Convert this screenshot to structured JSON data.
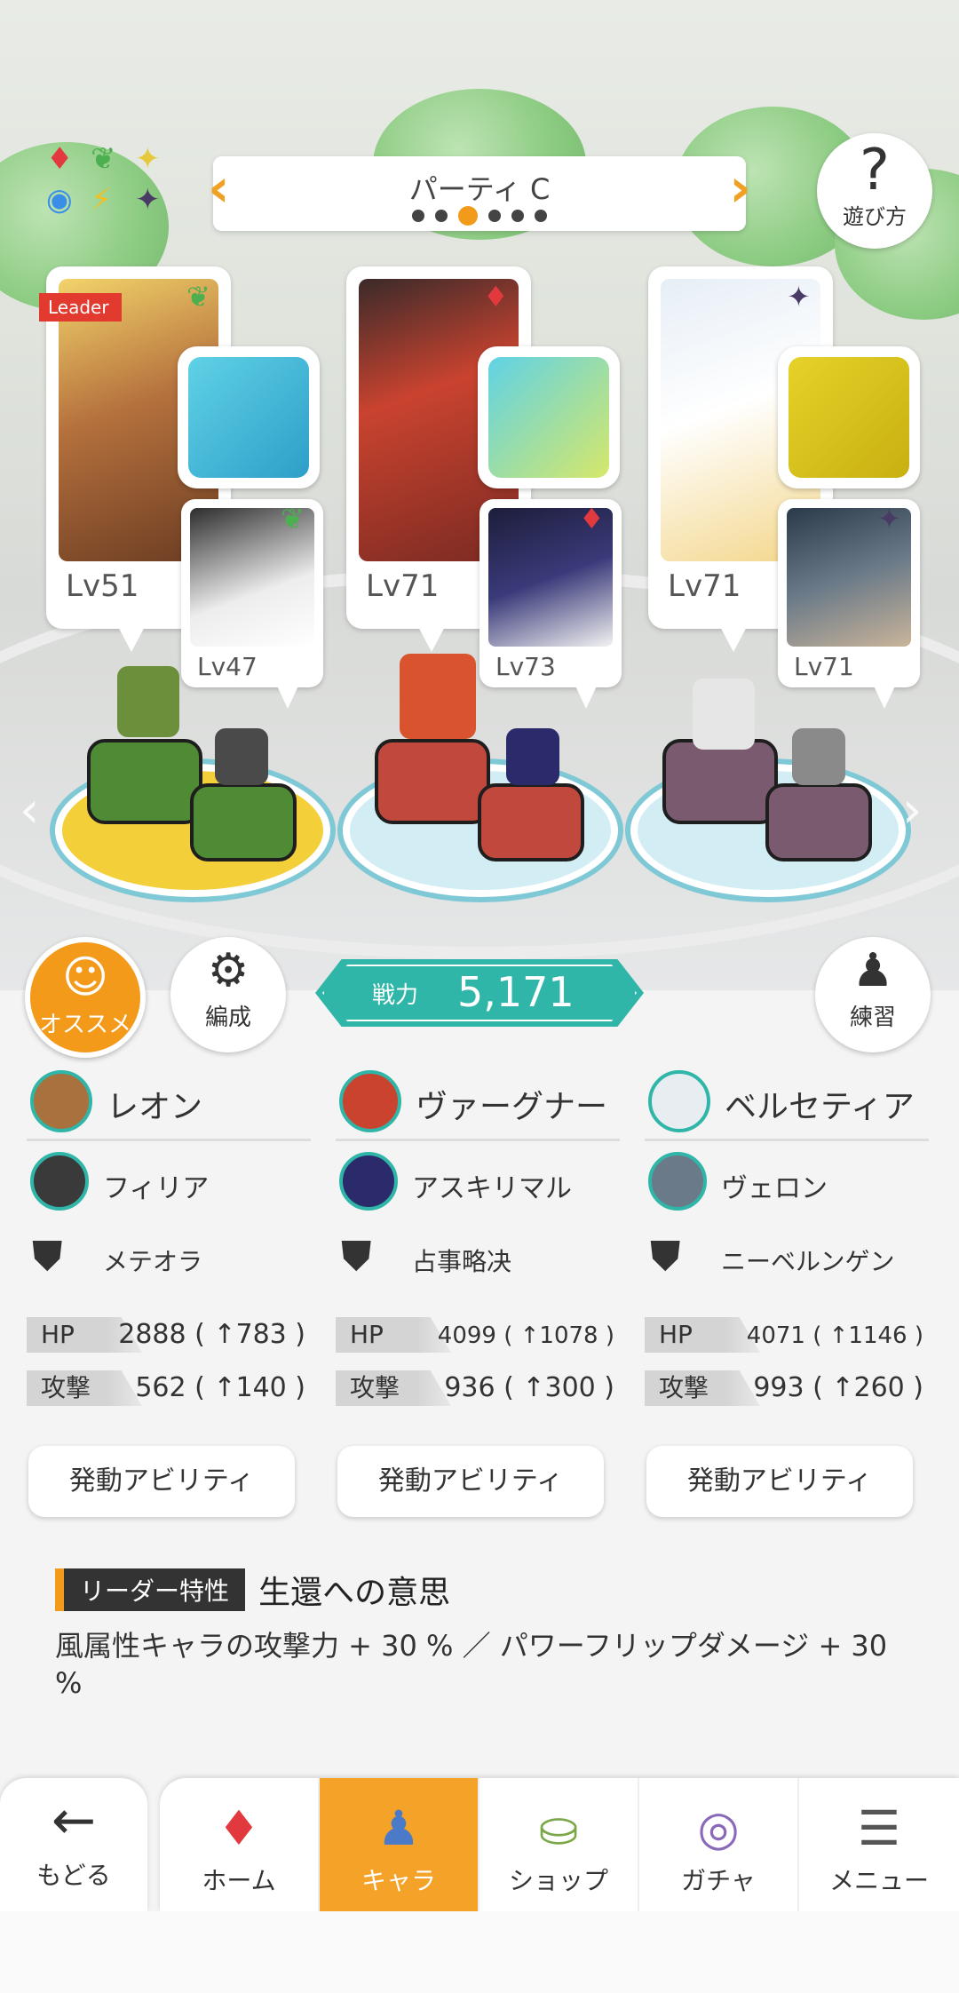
{
  "header": {
    "party_title": "パーティ C",
    "help_label": "遊び方",
    "help_icon": "question-icon",
    "party_dots_count": 6,
    "party_dots_active_index": 2
  },
  "attributes": [
    "diamond-red",
    "leaf-green",
    "sparkle-yellow",
    "circle-blue",
    "bolt-yellow",
    "star-dark"
  ],
  "leader_label": "Leader",
  "teams": [
    {
      "main_level": "Lv51",
      "sub_level": "Lv47",
      "attr": "leaf",
      "attr_color": "#4caf50",
      "leader": "レオン",
      "sub": "フィリア",
      "weapon": "メテオラ",
      "hp_label": "HP",
      "hp": "2888 ( ↑783 )",
      "atk_label": "攻撃",
      "atk": "562 ( ↑140 )",
      "ability": "発動アビリティ",
      "platform_color": "#5a8f3a"
    },
    {
      "main_level": "Lv71",
      "sub_level": "Lv73",
      "attr": "diamond",
      "attr_color": "#e2393f",
      "leader": "ヴァーグナー",
      "sub": "アスキリマル",
      "weapon": "占事略决",
      "hp_label": "HP",
      "hp": "4099 ( ↑1078 )",
      "atk_label": "攻撃",
      "atk": "936 ( ↑300 )",
      "ability": "発動アビリティ",
      "platform_color": "#c0483d"
    },
    {
      "main_level": "Lv71",
      "sub_level": "Lv71",
      "attr": "star",
      "attr_color": "#4a3a66",
      "leader": "ベルセティア",
      "sub": "ヴェロン",
      "weapon": "ニーベルンゲン",
      "hp_label": "HP",
      "hp": "4071 ( ↑1146 )",
      "atk_label": "攻撃",
      "atk": "993 ( ↑260 )",
      "ability": "発動アビリティ",
      "platform_color": "#7a5a6e"
    }
  ],
  "actions": {
    "recommend": "オススメ",
    "formation": "編成",
    "practice": "練習",
    "power_label": "戦力",
    "power_value": "5,171"
  },
  "leader_skill": {
    "tag": "リーダー特性",
    "name": "生還への意思",
    "desc": "風属性キャラの攻撃力 + 30 % ／ パワーフリップダメージ + 30 %"
  },
  "nav": {
    "back": "もどる",
    "items": [
      "ホーム",
      "キャラ",
      "ショップ",
      "ガチャ",
      "メニュー"
    ],
    "active": "キャラ"
  },
  "colors": {
    "accent": "#f39a1b",
    "teal": "#2fb6a8"
  }
}
